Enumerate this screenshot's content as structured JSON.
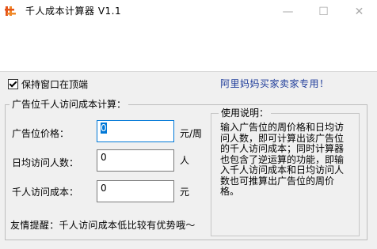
{
  "window": {
    "title": "千人成本计算器 V1.1",
    "controls": {
      "minimize": "—",
      "maximize": "☐",
      "close": "✕"
    }
  },
  "top_options": {
    "stay_on_top_label": "保持窗口在顶端",
    "stay_on_top_checked": true,
    "promo_text": "阿里妈妈买家卖家专用！"
  },
  "calculator": {
    "group_title": "广告位千人访问成本计算：",
    "fields": [
      {
        "label": "广告位价格：",
        "value": "0",
        "unit": "元/周"
      },
      {
        "label": "日均访问人数：",
        "value": "0",
        "unit": "人"
      },
      {
        "label": "千人访问成本：",
        "value": "0",
        "unit": "元"
      }
    ],
    "tip": "友情提醒：千人访问成本低比较有优势哦～"
  },
  "usage": {
    "title": "使用说明：",
    "text": "输入广告位的周价格和日均访问人数，即可计算出该广告位的千人访问成本；同时计算器也包含了逆运算的功能，即输入千人访问成本和日均访问人数也可推算出广告位的周价格。"
  },
  "colors": {
    "promo": "#1f3d9a",
    "focus": "#0078d7"
  }
}
